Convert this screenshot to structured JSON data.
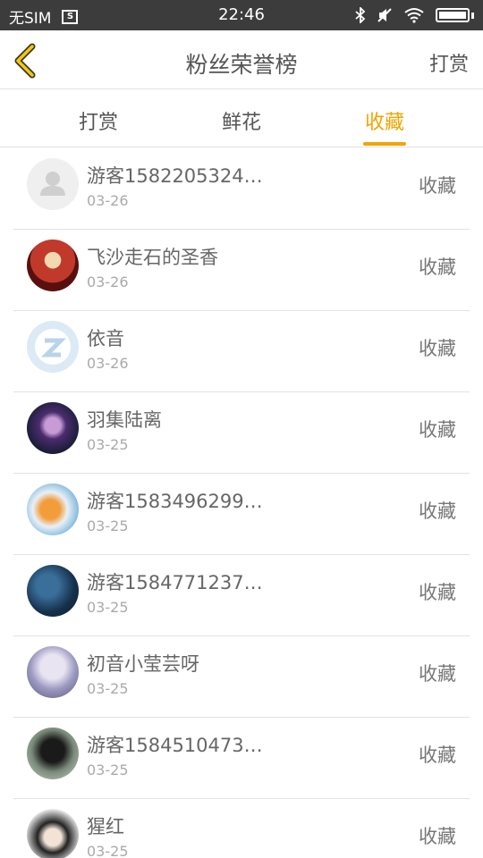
{
  "status_bar": {
    "carrier": "无SIM",
    "time": "22:46"
  },
  "header": {
    "back_icon": "chevron-left-icon",
    "title": "粉丝荣誉榜",
    "action": "打赏"
  },
  "tabs": [
    {
      "label": "打赏",
      "active": false
    },
    {
      "label": "鲜花",
      "active": false
    },
    {
      "label": "收藏",
      "active": true
    }
  ],
  "accent_color": "#f0a500",
  "rows": [
    {
      "name": "游客1582205324…",
      "date": "03-26",
      "action": "收藏"
    },
    {
      "name": "飞沙走石的圣香",
      "date": "03-26",
      "action": "收藏"
    },
    {
      "name": "依音",
      "date": "03-26",
      "action": "收藏"
    },
    {
      "name": "羽集陆离",
      "date": "03-25",
      "action": "收藏"
    },
    {
      "name": "游客1583496299…",
      "date": "03-25",
      "action": "收藏"
    },
    {
      "name": "游客1584771237…",
      "date": "03-25",
      "action": "收藏"
    },
    {
      "name": "初音小莹芸呀",
      "date": "03-25",
      "action": "收藏"
    },
    {
      "name": "游客1584510473…",
      "date": "03-25",
      "action": "收藏"
    },
    {
      "name": "猩红",
      "date": "03-25",
      "action": "收藏"
    }
  ]
}
